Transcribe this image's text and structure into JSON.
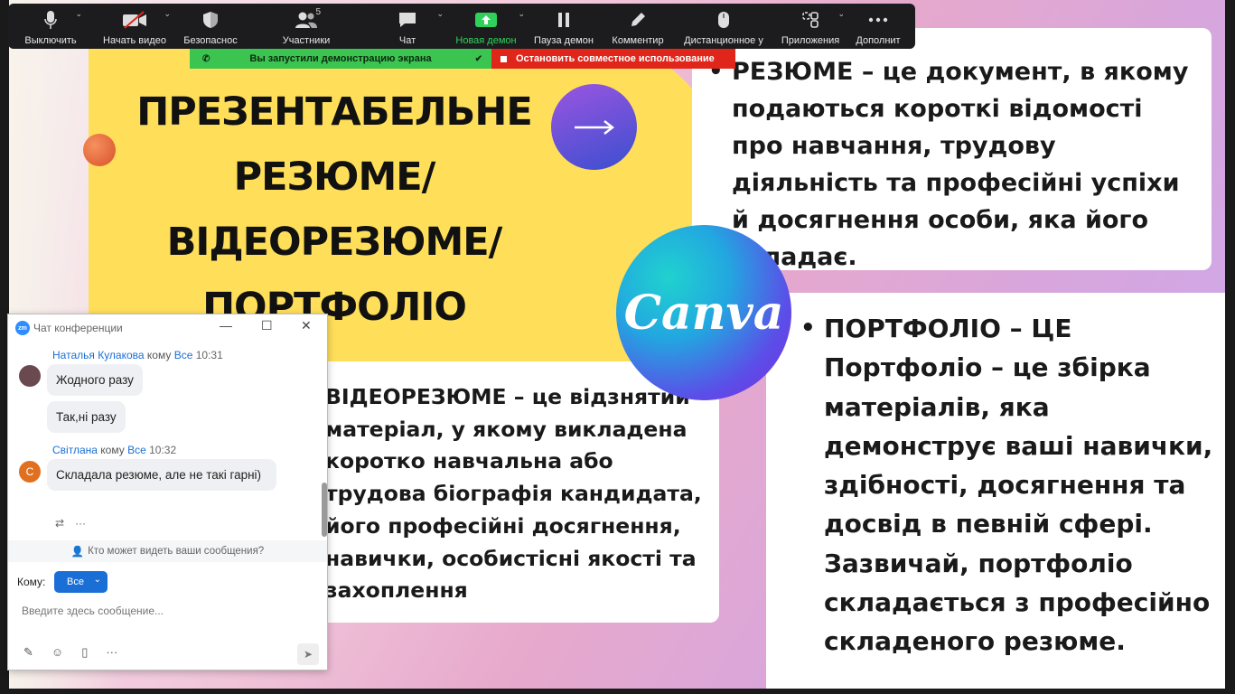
{
  "toolbar": {
    "items": [
      {
        "label": "Выключить",
        "icon": "microphone-icon"
      },
      {
        "label": "Начать видео",
        "icon": "video-off-icon"
      },
      {
        "label": "Безопаснос",
        "icon": "shield-icon"
      },
      {
        "label": "Участники",
        "icon": "participants-icon",
        "badge": "5"
      },
      {
        "label": "Чат",
        "icon": "chat-icon"
      },
      {
        "label": "Новая демон",
        "icon": "share-screen-icon",
        "accent": "#2fd15a"
      },
      {
        "label": "Пауза демон",
        "icon": "pause-icon"
      },
      {
        "label": "Комментир",
        "icon": "annotate-pen-icon"
      },
      {
        "label": "Дистанционное у",
        "icon": "mouse-icon"
      },
      {
        "label": "Приложения",
        "icon": "apps-icon"
      },
      {
        "label": "Дополнит",
        "icon": "more-dots-icon"
      }
    ]
  },
  "banner": {
    "sharing_text": "Вы запустили демонстрацию экрана",
    "stop_text": "Остановить совместное использование",
    "green": "#3cc450",
    "red": "#e0251b"
  },
  "slide": {
    "title_lines": [
      "ПРЕЗЕНТАБЕЛЬНЕ",
      "РЕЗЮМЕ/",
      "ВІДЕОРЕЗЮМЕ/",
      "ПОРТФОЛІО"
    ],
    "logo_text": "Canva",
    "resume_text": "РЕЗЮМЕ – це документ, в якому подаються короткі відомості про навчання, трудову діяльність та професійні успіхи й досягнення особи, яка його складає.",
    "video_lines": [
      "ВІДЕОРЕЗЮМЕ – це відзнятий",
      "матеріал, у якому викладена",
      "коротко навчальна або",
      "трудова біографія кандидата,",
      "його професійні досягнення,",
      "навички, особистісні якості та",
      "захоплення"
    ],
    "portfolio_text": "ПОРТФОЛІО – ЦЕ Портфоліо – це збірка матеріалів, яка демонструє ваші навички, здібності, досягнення та досвід в певній сфері. Зазвичай, портфоліо складається з професійно складеного резюме.",
    "bullet": "•"
  },
  "chat": {
    "title": "Чат конференции",
    "logo": "zm",
    "messages": [
      {
        "sender": "Наталья Кулакова",
        "to_word": "кому",
        "recipient": "Все",
        "time": "10:31",
        "texts": [
          "Жодного разу",
          "Так,ні разу"
        ]
      },
      {
        "sender": "Світлана",
        "to_word": "кому",
        "recipient": "Все",
        "time": "10:32",
        "avatar_letter": "С",
        "texts": [
          "Складала резюме, але не такі гарні)"
        ]
      }
    ],
    "who_can_see": "Кто может видеть ваши сообщения?",
    "to_label": "Кому:",
    "to_value": "Все",
    "input_placeholder": "Введите здесь сообщение...",
    "more": "···"
  }
}
